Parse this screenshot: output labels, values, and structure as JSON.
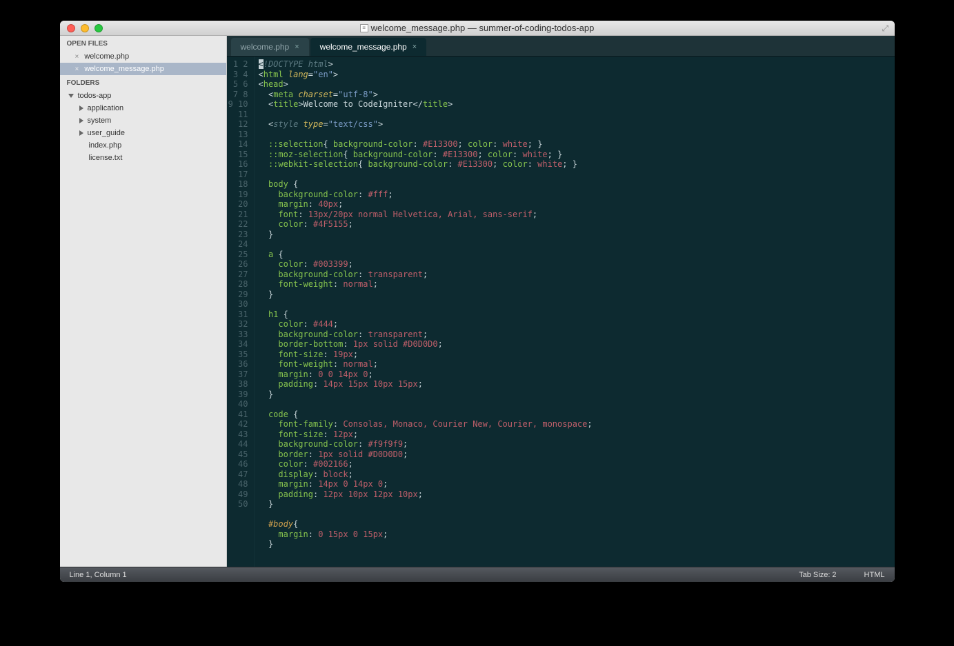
{
  "window": {
    "title": "welcome_message.php — summer-of-coding-todos-app"
  },
  "sidebar": {
    "open_files_header": "OPEN FILES",
    "open_files": [
      {
        "name": "welcome.php",
        "selected": false
      },
      {
        "name": "welcome_message.php",
        "selected": true
      }
    ],
    "folders_header": "FOLDERS",
    "root_folder": "todos-app",
    "folders": [
      {
        "name": "application"
      },
      {
        "name": "system"
      },
      {
        "name": "user_guide"
      }
    ],
    "files": [
      {
        "name": "index.php"
      },
      {
        "name": "license.txt"
      }
    ]
  },
  "tabs": [
    {
      "label": "welcome.php",
      "active": false
    },
    {
      "label": "welcome_message.php",
      "active": true
    }
  ],
  "code_lines": [
    {
      "n": 1,
      "html": "<span class='c-punct'><span class='cursor-block'>&lt;</span></span><span class='c-comment'>!DOCTYPE html</span><span class='c-punct'>&gt;</span>"
    },
    {
      "n": 2,
      "html": "<span class='c-punct'>&lt;</span><span class='c-tag'>html</span> <span class='c-attr'>lang</span><span class='c-punct'>=</span><span class='c-str'>\"en\"</span><span class='c-punct'>&gt;</span>"
    },
    {
      "n": 3,
      "html": "<span class='c-punct'>&lt;</span><span class='c-tag'>head</span><span class='c-punct'>&gt;</span>"
    },
    {
      "n": 4,
      "html": "  <span class='c-punct'>&lt;</span><span class='c-tag'>meta</span> <span class='c-attr'>charset</span><span class='c-punct'>=</span><span class='c-str'>\"utf-8\"</span><span class='c-punct'>&gt;</span>"
    },
    {
      "n": 5,
      "html": "  <span class='c-punct'>&lt;</span><span class='c-tag'>title</span><span class='c-punct'>&gt;</span>Welcome to CodeIgniter<span class='c-punct'>&lt;/</span><span class='c-tag'>title</span><span class='c-punct'>&gt;</span>"
    },
    {
      "n": 6,
      "html": ""
    },
    {
      "n": 7,
      "html": "  <span class='c-punct'>&lt;</span><span class='c-comment'>style</span> <span class='c-attr'>type</span><span class='c-punct'>=</span><span class='c-str'>\"text/css\"</span><span class='c-punct'>&gt;</span>"
    },
    {
      "n": 8,
      "html": ""
    },
    {
      "n": 9,
      "html": "  <span class='c-sel'>::selection</span><span class='c-brace'>{</span> <span class='c-prop'>background-color</span><span class='c-punct'>:</span> <span class='c-val'>#E13300</span><span class='c-punct'>;</span> <span class='c-prop'>color</span><span class='c-punct'>:</span> <span class='c-val'>white</span><span class='c-punct'>;</span> <span class='c-brace'>}</span>"
    },
    {
      "n": 10,
      "html": "  <span class='c-sel'>::moz-selection</span><span class='c-brace'>{</span> <span class='c-prop'>background-color</span><span class='c-punct'>:</span> <span class='c-val'>#E13300</span><span class='c-punct'>;</span> <span class='c-prop'>color</span><span class='c-punct'>:</span> <span class='c-val'>white</span><span class='c-punct'>;</span> <span class='c-brace'>}</span>"
    },
    {
      "n": 11,
      "html": "  <span class='c-sel'>::webkit-selection</span><span class='c-brace'>{</span> <span class='c-prop'>background-color</span><span class='c-punct'>:</span> <span class='c-val'>#E13300</span><span class='c-punct'>;</span> <span class='c-prop'>color</span><span class='c-punct'>:</span> <span class='c-val'>white</span><span class='c-punct'>;</span> <span class='c-brace'>}</span>"
    },
    {
      "n": 12,
      "html": ""
    },
    {
      "n": 13,
      "html": "  <span class='c-sel'>body</span> <span class='c-brace'>{</span>"
    },
    {
      "n": 14,
      "html": "    <span class='c-prop'>background-color</span><span class='c-punct'>:</span> <span class='c-val'>#fff</span><span class='c-punct'>;</span>"
    },
    {
      "n": 15,
      "html": "    <span class='c-prop'>margin</span><span class='c-punct'>:</span> <span class='c-val'>40px</span><span class='c-punct'>;</span>"
    },
    {
      "n": 16,
      "html": "    <span class='c-prop'>font</span><span class='c-punct'>:</span> <span class='c-val'>13px/20px normal Helvetica, Arial, sans-serif</span><span class='c-punct'>;</span>"
    },
    {
      "n": 17,
      "html": "    <span class='c-prop'>color</span><span class='c-punct'>:</span> <span class='c-val'>#4F5155</span><span class='c-punct'>;</span>"
    },
    {
      "n": 18,
      "html": "  <span class='c-brace'>}</span>"
    },
    {
      "n": 19,
      "html": ""
    },
    {
      "n": 20,
      "html": "  <span class='c-sel'>a</span> <span class='c-brace'>{</span>"
    },
    {
      "n": 21,
      "html": "    <span class='c-prop'>color</span><span class='c-punct'>:</span> <span class='c-val'>#003399</span><span class='c-punct'>;</span>"
    },
    {
      "n": 22,
      "html": "    <span class='c-prop'>background-color</span><span class='c-punct'>:</span> <span class='c-val'>transparent</span><span class='c-punct'>;</span>"
    },
    {
      "n": 23,
      "html": "    <span class='c-prop'>font-weight</span><span class='c-punct'>:</span> <span class='c-val'>normal</span><span class='c-punct'>;</span>"
    },
    {
      "n": 24,
      "html": "  <span class='c-brace'>}</span>"
    },
    {
      "n": 25,
      "html": ""
    },
    {
      "n": 26,
      "html": "  <span class='c-sel'>h1</span> <span class='c-brace'>{</span>"
    },
    {
      "n": 27,
      "html": "    <span class='c-prop'>color</span><span class='c-punct'>:</span> <span class='c-val'>#444</span><span class='c-punct'>;</span>"
    },
    {
      "n": 28,
      "html": "    <span class='c-prop'>background-color</span><span class='c-punct'>:</span> <span class='c-val'>transparent</span><span class='c-punct'>;</span>"
    },
    {
      "n": 29,
      "html": "    <span class='c-prop'>border-bottom</span><span class='c-punct'>:</span> <span class='c-val'>1px solid #D0D0D0</span><span class='c-punct'>;</span>"
    },
    {
      "n": 30,
      "html": "    <span class='c-prop'>font-size</span><span class='c-punct'>:</span> <span class='c-val'>19px</span><span class='c-punct'>;</span>"
    },
    {
      "n": 31,
      "html": "    <span class='c-prop'>font-weight</span><span class='c-punct'>:</span> <span class='c-val'>normal</span><span class='c-punct'>;</span>"
    },
    {
      "n": 32,
      "html": "    <span class='c-prop'>margin</span><span class='c-punct'>:</span> <span class='c-val'>0 0 14px 0</span><span class='c-punct'>;</span>"
    },
    {
      "n": 33,
      "html": "    <span class='c-prop'>padding</span><span class='c-punct'>:</span> <span class='c-val'>14px 15px 10px 15px</span><span class='c-punct'>;</span>"
    },
    {
      "n": 34,
      "html": "  <span class='c-brace'>}</span>"
    },
    {
      "n": 35,
      "html": ""
    },
    {
      "n": 36,
      "html": "  <span class='c-sel'>code</span> <span class='c-brace'>{</span>"
    },
    {
      "n": 37,
      "html": "    <span class='c-prop'>font-family</span><span class='c-punct'>:</span> <span class='c-val'>Consolas, Monaco, Courier New, Courier, monospace</span><span class='c-punct'>;</span>"
    },
    {
      "n": 38,
      "html": "    <span class='c-prop'>font-size</span><span class='c-punct'>:</span> <span class='c-val'>12px</span><span class='c-punct'>;</span>"
    },
    {
      "n": 39,
      "html": "    <span class='c-prop'>background-color</span><span class='c-punct'>:</span> <span class='c-val'>#f9f9f9</span><span class='c-punct'>;</span>"
    },
    {
      "n": 40,
      "html": "    <span class='c-prop'>border</span><span class='c-punct'>:</span> <span class='c-val'>1px solid #D0D0D0</span><span class='c-punct'>;</span>"
    },
    {
      "n": 41,
      "html": "    <span class='c-prop'>color</span><span class='c-punct'>:</span> <span class='c-val'>#002166</span><span class='c-punct'>;</span>"
    },
    {
      "n": 42,
      "html": "    <span class='c-prop'>display</span><span class='c-punct'>:</span> <span class='c-val'>block</span><span class='c-punct'>;</span>"
    },
    {
      "n": 43,
      "html": "    <span class='c-prop'>margin</span><span class='c-punct'>:</span> <span class='c-val'>14px 0 14px 0</span><span class='c-punct'>;</span>"
    },
    {
      "n": 44,
      "html": "    <span class='c-prop'>padding</span><span class='c-punct'>:</span> <span class='c-val'>12px 10px 12px 10px</span><span class='c-punct'>;</span>"
    },
    {
      "n": 45,
      "html": "  <span class='c-brace'>}</span>"
    },
    {
      "n": 46,
      "html": ""
    },
    {
      "n": 47,
      "html": "  <span class='c-id'>#body</span><span class='c-brace'>{</span>"
    },
    {
      "n": 48,
      "html": "    <span class='c-prop'>margin</span><span class='c-punct'>:</span> <span class='c-val'>0 15px 0 15px</span><span class='c-punct'>;</span>"
    },
    {
      "n": 49,
      "html": "  <span class='c-brace'>}</span>"
    },
    {
      "n": 50,
      "html": ""
    }
  ],
  "statusbar": {
    "left": "Line 1, Column 1",
    "tab_size": "Tab Size: 2",
    "syntax": "HTML"
  }
}
